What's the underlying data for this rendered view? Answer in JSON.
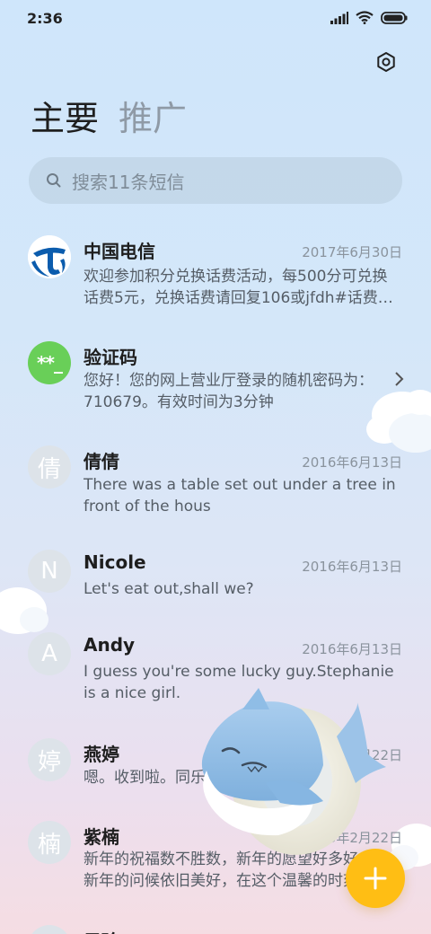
{
  "status_bar": {
    "time": "2:36"
  },
  "tabs": [
    {
      "label": "主要",
      "active": true
    },
    {
      "label": "推广",
      "active": false
    }
  ],
  "search": {
    "placeholder": "搜索11条短信"
  },
  "messages": [
    {
      "name": "中国电信",
      "date": "2017年6月30日",
      "preview": "欢迎参加积分兑换话费活动，每500分可兑换话费5元，兑换话费请回复106或jfdh#话费…",
      "avatar": "telecom-logo"
    },
    {
      "name": "验证码",
      "date": "",
      "preview": "您好！您的网上营业厅登录的随机密码为：710679。有效时间为3分钟",
      "avatar_text": "**_"
    },
    {
      "name": "倩倩",
      "date": "2016年6月13日",
      "preview": "There was a table set out under a tree in front of the hous",
      "avatar_text": "倩"
    },
    {
      "name": "Nicole",
      "date": "2016年6月13日",
      "preview": "Let's eat out,shall we?",
      "avatar_text": "N"
    },
    {
      "name": "Andy",
      "date": "2016年6月13日",
      "preview": "I guess you're some lucky guy.Stephanie is a nice girl.",
      "avatar_text": "A"
    },
    {
      "name": "燕婷",
      "date": "2013年2月22日",
      "preview": "嗯。收到啦。同乐同乐。",
      "avatar_text": "婷"
    },
    {
      "name": "紫楠",
      "date": "2013年2月22日",
      "preview": "新年的祝福数不胜数，新年的愿望好多好多，新年的问候依旧美好，在这个温馨的时刻",
      "avatar_text": "楠"
    },
    {
      "name": "子玲",
      "date": "",
      "preview": "",
      "avatar_text": "玲"
    }
  ],
  "colors": {
    "accent_fab": "#ffbe14",
    "verify_avatar": "#69cf58",
    "telecom_blue": "#0b5cad"
  }
}
